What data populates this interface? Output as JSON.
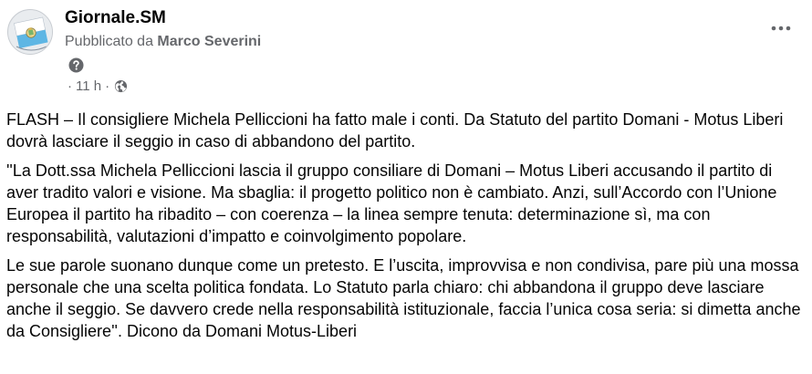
{
  "post": {
    "page_name": "Giornale.SM",
    "byline_prefix": "Pubblicato da",
    "author": "Marco Severini",
    "dot": "·",
    "timestamp": "11 h",
    "icons": {
      "avatar": "san-marino-flag-avatar",
      "help": "question-mark-icon",
      "audience": "globe-icon",
      "more": "more-options-icon"
    },
    "paragraphs": [
      "FLASH – Il consigliere Michela Pelliccioni ha fatto male i conti. Da Statuto del partito Domani - Motus Liberi dovrà lasciare il seggio in caso di abbandono del partito.",
      "''La Dott.ssa Michela Pelliccioni lascia il gruppo consiliare di Domani – Motus Liberi accusando il partito di aver tradito valori e visione. Ma sbaglia: il progetto politico non è cambiato. Anzi, sull’Accordo con l’Unione Europea il partito ha ribadito – con coerenza – la linea sempre tenuta: determinazione sì, ma con responsabilità, valutazioni d’impatto e coinvolgimento popolare.",
      "Le sue parole suonano dunque come un pretesto. E l’uscita, improvvisa e non condivisa, pare più una mossa personale che una scelta politica fondata. Lo Statuto parla chiaro: chi abbandona il gruppo deve lasciare anche il seggio. Se davvero crede nella responsabilità istituzionale, faccia l’unica cosa seria: si dimetta anche da Consigliere''. Dicono da Domani Motus-Liberi"
    ]
  },
  "colors": {
    "text": "#050505",
    "secondary_text": "#65676b",
    "icon_gray": "#65676b",
    "flag_white": "#ffffff",
    "flag_blue": "#5eb6e4"
  }
}
